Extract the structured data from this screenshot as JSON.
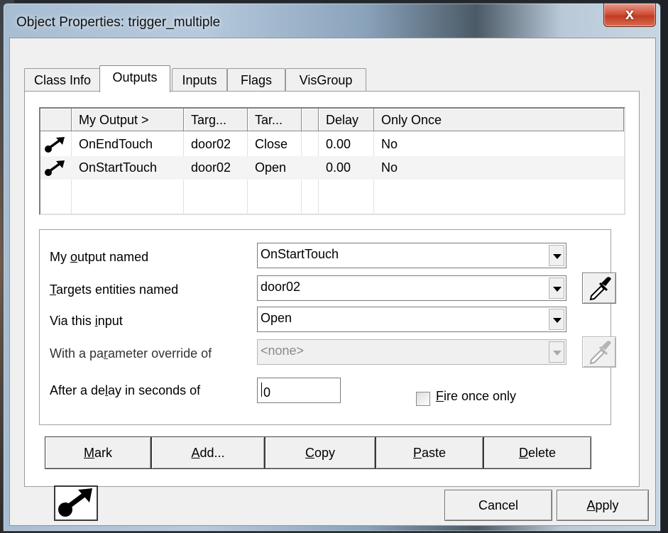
{
  "window": {
    "title": "Object Properties: trigger_multiple",
    "close_glyph": "x"
  },
  "tabs": [
    {
      "label": "Class Info"
    },
    {
      "label": "Outputs"
    },
    {
      "label": "Inputs"
    },
    {
      "label": "Flags"
    },
    {
      "label": "VisGroup"
    }
  ],
  "grid": {
    "columns": [
      "",
      "My Output  >",
      "Targ...",
      "Tar...",
      "",
      "Delay",
      "Only Once"
    ],
    "rows": [
      {
        "icon": "output-arrow-icon",
        "output": "OnEndTouch",
        "target": "door02",
        "input": "Close",
        "param": "",
        "delay": "0.00",
        "once": "No"
      },
      {
        "icon": "output-arrow-icon",
        "output": "OnStartTouch",
        "target": "door02",
        "input": "Open",
        "param": "",
        "delay": "0.00",
        "once": "No"
      }
    ]
  },
  "form": {
    "output_label": {
      "pre": "My ",
      "u": "o",
      "post": "utput named"
    },
    "output_value": "OnStartTouch",
    "target_label": {
      "pre": "",
      "u": "T",
      "post": "argets entities named"
    },
    "target_value": "door02",
    "input_label": {
      "pre": "Via this ",
      "u": "i",
      "post": "nput"
    },
    "input_value": "Open",
    "param_label": {
      "pre": "With a pa",
      "u": "r",
      "post": "ameter override of"
    },
    "param_value": "<none>",
    "delay_label": {
      "pre": "After a de",
      "u": "l",
      "post": "ay in seconds of"
    },
    "delay_value": "0",
    "fire_once": {
      "u": "F",
      "post": "ire once only",
      "checked": false
    }
  },
  "buttons": {
    "mark": {
      "u": "M",
      "post": "ark"
    },
    "add": {
      "u": "A",
      "post": "dd..."
    },
    "copy": {
      "u": "C",
      "post": "opy"
    },
    "paste": {
      "u": "P",
      "post": "aste"
    },
    "delete": {
      "u": "D",
      "post": "elete"
    },
    "cancel": "Cancel",
    "apply": {
      "u": "A",
      "post": "pply"
    }
  },
  "colors": {
    "close": "#c13c23",
    "accent_frame": "#a7bdd2"
  }
}
